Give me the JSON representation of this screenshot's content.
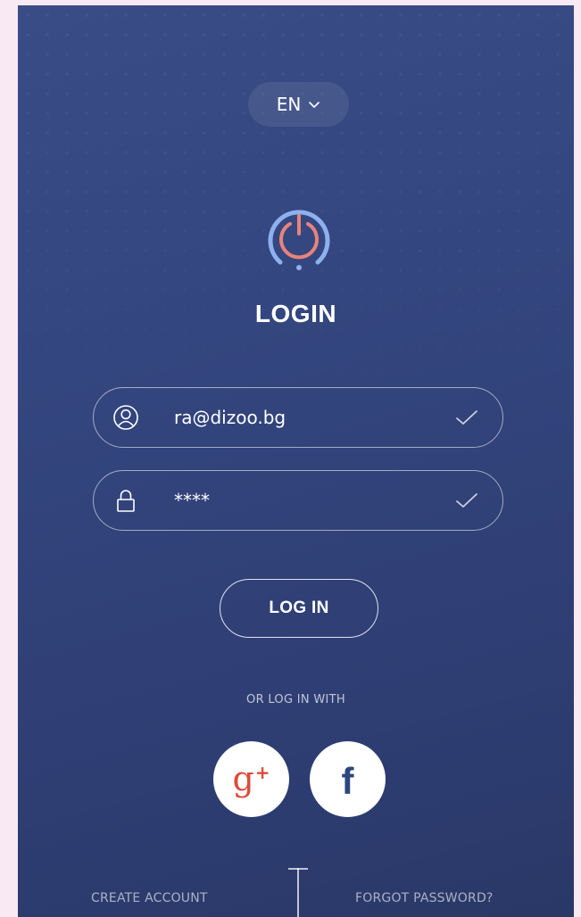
{
  "language": {
    "selected": "EN",
    "chevron_icon": "chevron-down-icon"
  },
  "brand": {
    "icon": "power-icon",
    "accent_color": "#e8837a",
    "ring_color": "#8fb0ef"
  },
  "page": {
    "title": "LOGIN"
  },
  "form": {
    "email": {
      "icon": "user-icon",
      "value": "ra@dizoo.bg",
      "valid_icon": "check-icon"
    },
    "password": {
      "icon": "lock-icon",
      "value": "****",
      "valid_icon": "check-icon"
    },
    "submit_label": "LOG IN"
  },
  "social": {
    "heading": "OR LOG IN WITH",
    "google": {
      "icon": "google-plus-icon",
      "glyph": "g",
      "plus": "+",
      "color": "#dd4b39"
    },
    "facebook": {
      "icon": "facebook-icon",
      "glyph": "f",
      "color": "#2d4680"
    }
  },
  "footer": {
    "create_account": "CREATE ACCOUNT",
    "forgot_password": "FORGOT PASSWORD?"
  }
}
